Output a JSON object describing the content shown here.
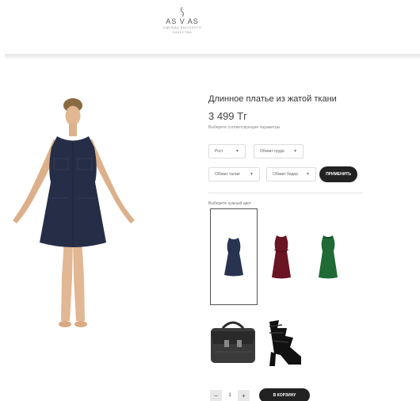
{
  "header": {
    "logo_text": "AS V AS",
    "logo_tagline": "ОДЕЖДА ВЫСОКОГО КАЧЕСТВА"
  },
  "product": {
    "title": "Длинное платье из жатой ткани",
    "price": "3 499 Тг",
    "params_hint": "Выберите соответсвующие параметры"
  },
  "filters": {
    "height_label": "Рост",
    "chest_label": "Обхват груди",
    "waist_label": "Обхват талии",
    "hips_label": "Обхват бедер",
    "apply_label": "ПРИМЕНИТЬ"
  },
  "colors": {
    "hint": "Выберите нужный цвет",
    "options": [
      {
        "name": "navy",
        "hex": "#283350",
        "selected": true
      },
      {
        "name": "wine",
        "hex": "#6b1424",
        "selected": false
      },
      {
        "name": "green",
        "hex": "#1f6a35",
        "selected": false
      }
    ]
  },
  "cart": {
    "quantity": "1",
    "minus_label": "−",
    "plus_label": "+",
    "add_label": "В КОРЗИНУ"
  }
}
